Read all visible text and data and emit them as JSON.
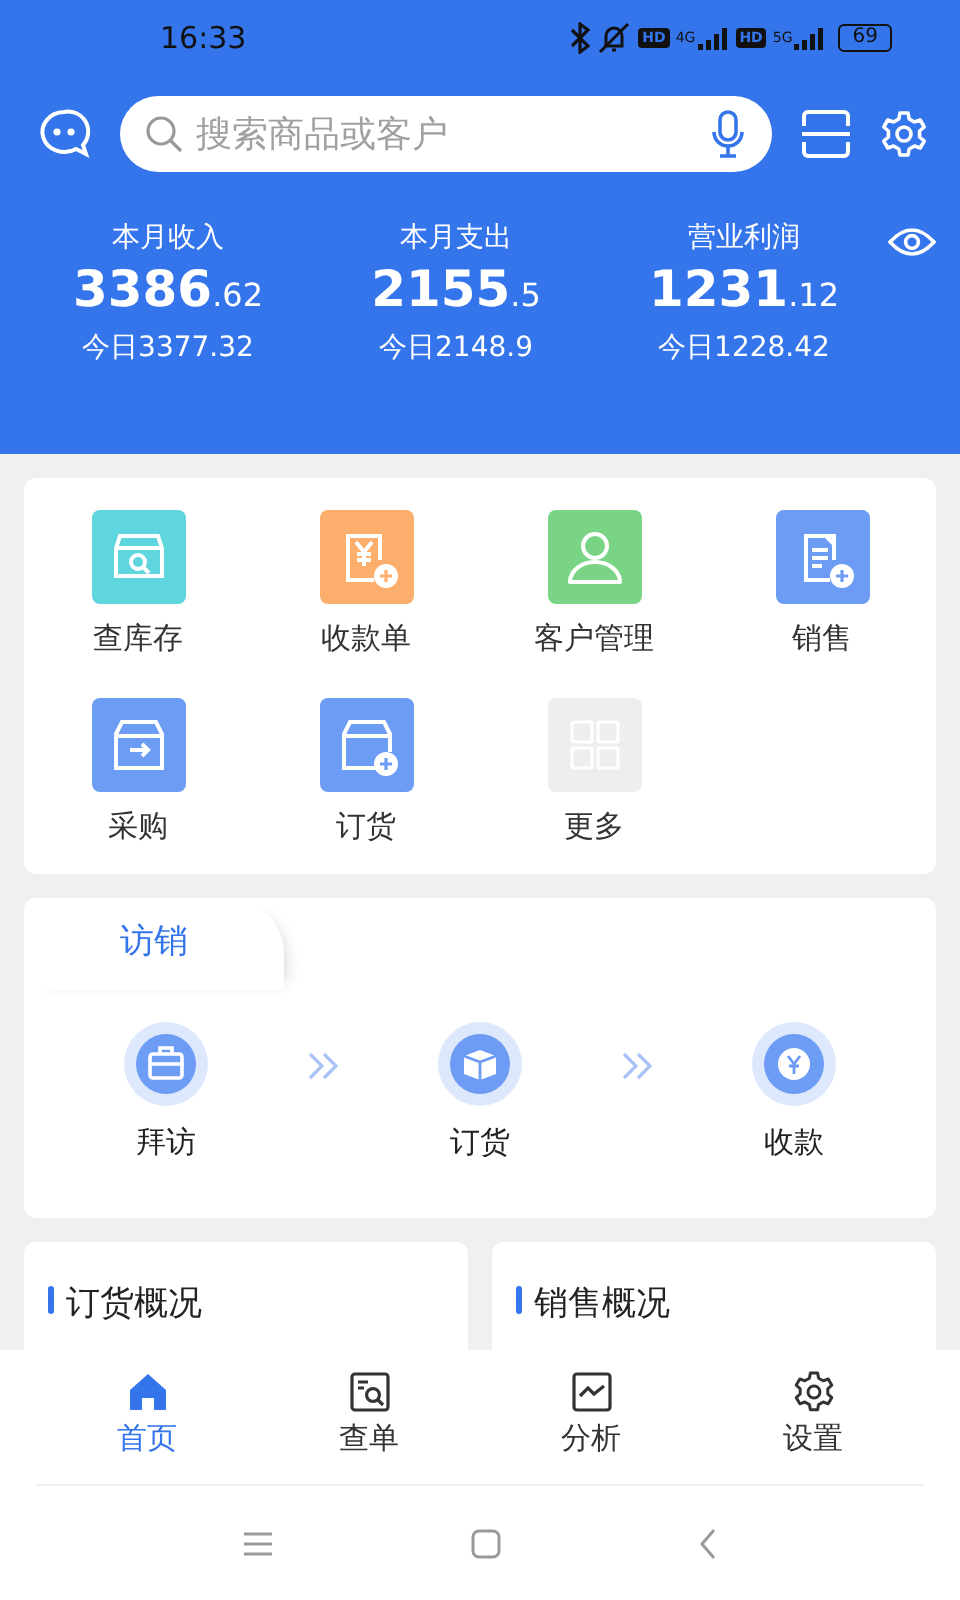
{
  "status_bar": {
    "time": "16:33",
    "hd_1": "HD",
    "network_1": "4G",
    "hd_2": "HD",
    "network_2": "5G",
    "battery": "69"
  },
  "search": {
    "placeholder": "搜索商品或客户"
  },
  "stats": [
    {
      "label": "本月收入",
      "value": "3386",
      "fraction": ".62",
      "today": "今日3377.32"
    },
    {
      "label": "本月支出",
      "value": "2155",
      "fraction": ".5",
      "today": "今日2148.9"
    },
    {
      "label": "营业利润",
      "value": "1231",
      "fraction": ".12",
      "today": "今日1228.42"
    }
  ],
  "shortcuts": [
    {
      "label": "查库存",
      "kind": "stock",
      "color": "#5fd6de"
    },
    {
      "label": "收款单",
      "kind": "receipt",
      "color": "#fcae6c"
    },
    {
      "label": "客户管理",
      "kind": "customer",
      "color": "#7ad486"
    },
    {
      "label": "销售",
      "kind": "document",
      "color": "#6c9cf4"
    },
    {
      "label": "采购",
      "kind": "purchase",
      "color": "#6c9cf4"
    },
    {
      "label": "订货",
      "kind": "order",
      "color": "#6c9cf4"
    },
    {
      "label": "更多",
      "kind": "more",
      "color": "#eeeeee"
    }
  ],
  "visit_sales": {
    "tab": "访销",
    "steps": [
      {
        "label": "拜访",
        "kind": "briefcase"
      },
      {
        "label": "订货",
        "kind": "parcel"
      },
      {
        "label": "收款",
        "kind": "coin"
      }
    ]
  },
  "overview_cards": [
    {
      "title": "订货概况"
    },
    {
      "title": "销售概况"
    }
  ],
  "bottom_nav": [
    {
      "label": "首页",
      "kind": "home",
      "selected": true
    },
    {
      "label": "查单",
      "kind": "search-doc",
      "selected": false
    },
    {
      "label": "分析",
      "kind": "chart",
      "selected": false
    },
    {
      "label": "设置",
      "kind": "settings",
      "selected": false
    }
  ]
}
